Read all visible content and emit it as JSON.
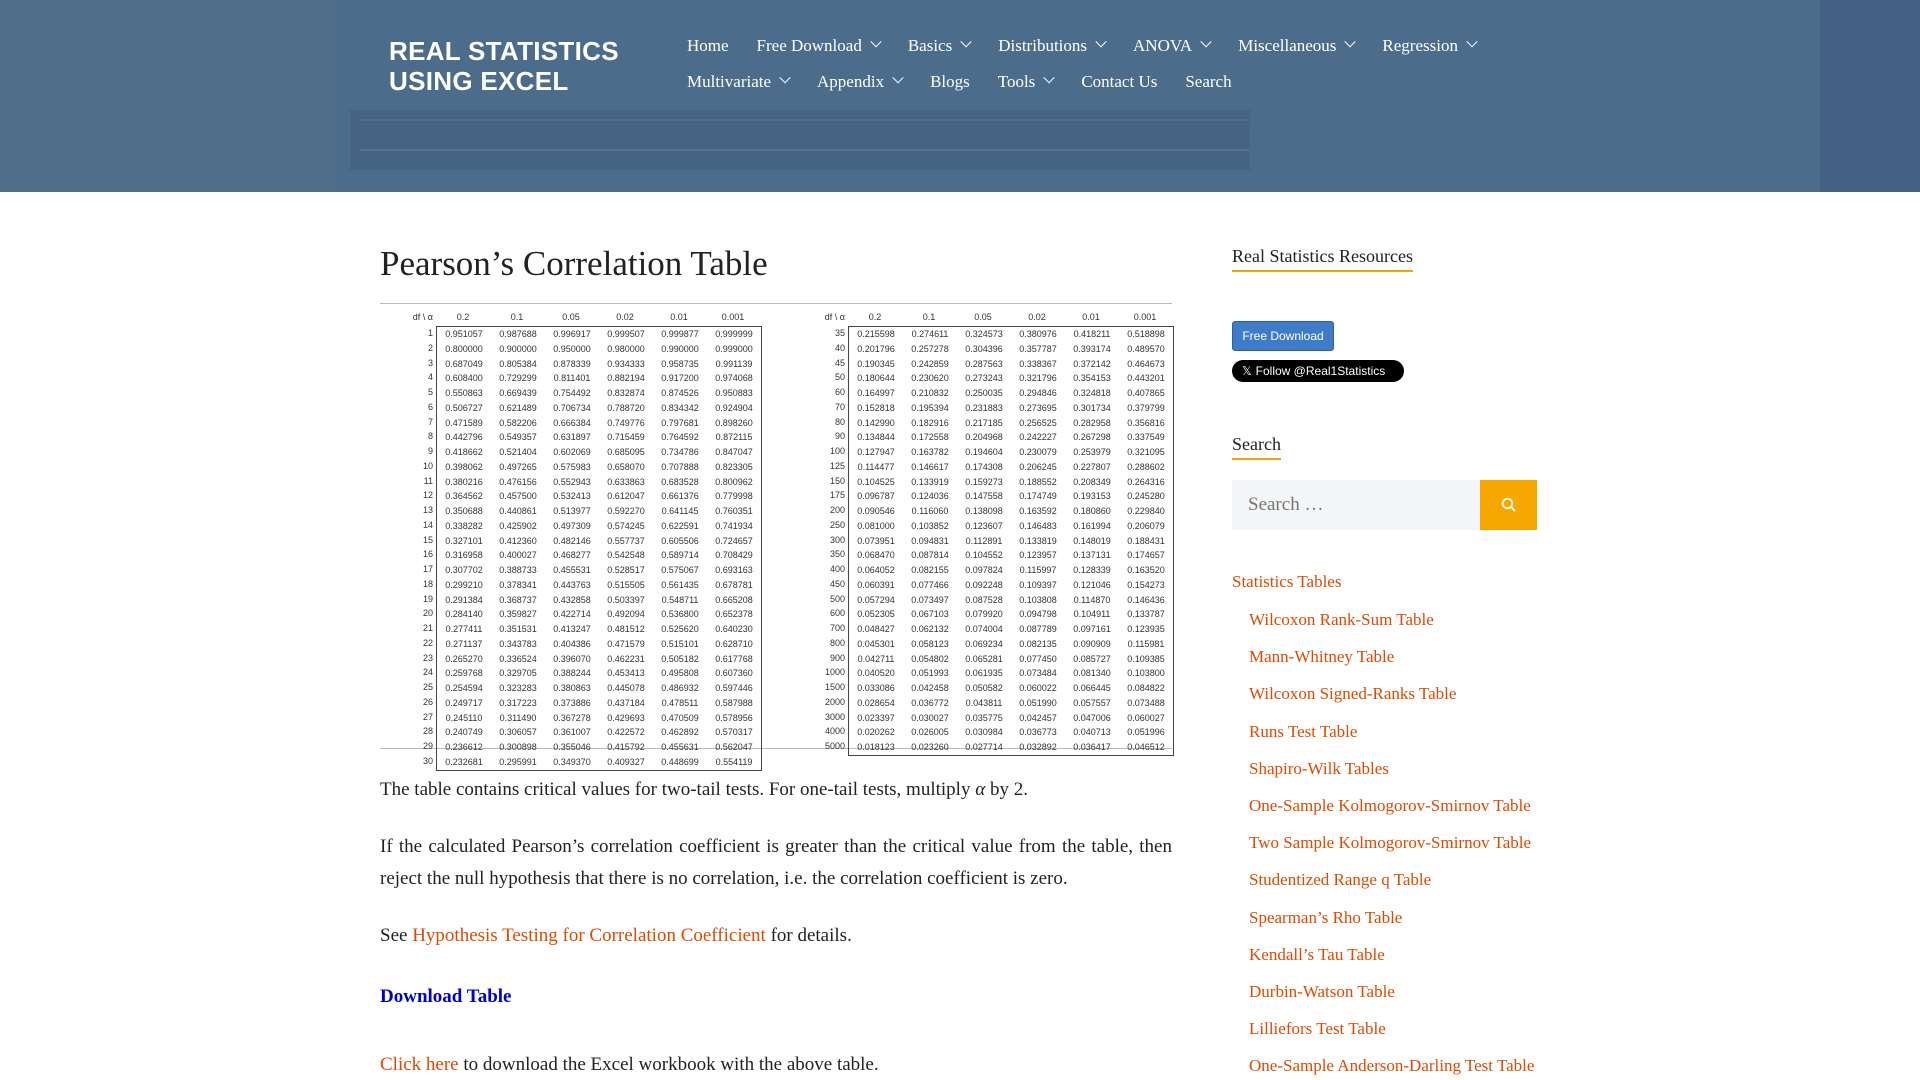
{
  "site": {
    "title_line1": "REAL STATISTICS",
    "title_line2": "USING EXCEL"
  },
  "nav": {
    "row1": [
      {
        "label": "Home",
        "dropdown": false
      },
      {
        "label": "Free Download",
        "dropdown": true
      },
      {
        "label": "Basics",
        "dropdown": true
      },
      {
        "label": "Distributions",
        "dropdown": true
      },
      {
        "label": "ANOVA",
        "dropdown": true
      },
      {
        "label": "Miscellaneous",
        "dropdown": true
      },
      {
        "label": "Regression",
        "dropdown": true
      }
    ],
    "row2": [
      {
        "label": "Multivariate",
        "dropdown": true
      },
      {
        "label": "Appendix",
        "dropdown": true
      },
      {
        "label": "Blogs",
        "dropdown": false
      },
      {
        "label": "Tools",
        "dropdown": true
      },
      {
        "label": "Contact Us",
        "dropdown": false
      },
      {
        "label": "Search",
        "dropdown": false
      }
    ]
  },
  "main": {
    "title": "Pearson’s Correlation Table",
    "table": {
      "corner": "df \\ α",
      "alphas": [
        "0.2",
        "0.1",
        "0.05",
        "0.02",
        "0.01",
        "0.001"
      ],
      "left": [
        [
          "1",
          "0.951057",
          "0.987688",
          "0.996917",
          "0.999507",
          "0.999877",
          "0.999999"
        ],
        [
          "2",
          "0.800000",
          "0.900000",
          "0.950000",
          "0.980000",
          "0.990000",
          "0.999000"
        ],
        [
          "3",
          "0.687049",
          "0.805384",
          "0.878339",
          "0.934333",
          "0.958735",
          "0.991139"
        ],
        [
          "4",
          "0.608400",
          "0.729299",
          "0.811401",
          "0.882194",
          "0.917200",
          "0.974068"
        ],
        [
          "5",
          "0.550863",
          "0.669439",
          "0.754492",
          "0.832874",
          "0.874526",
          "0.950883"
        ],
        [
          "6",
          "0.506727",
          "0.621489",
          "0.706734",
          "0.788720",
          "0.834342",
          "0.924904"
        ],
        [
          "7",
          "0.471589",
          "0.582206",
          "0.666384",
          "0.749776",
          "0.797681",
          "0.898260"
        ],
        [
          "8",
          "0.442796",
          "0.549357",
          "0.631897",
          "0.715459",
          "0.764592",
          "0.872115"
        ],
        [
          "9",
          "0.418662",
          "0.521404",
          "0.602069",
          "0.685095",
          "0.734786",
          "0.847047"
        ],
        [
          "10",
          "0.398062",
          "0.497265",
          "0.575983",
          "0.658070",
          "0.707888",
          "0.823305"
        ],
        [
          "11",
          "0.380216",
          "0.476156",
          "0.552943",
          "0.633863",
          "0.683528",
          "0.800962"
        ],
        [
          "12",
          "0.364562",
          "0.457500",
          "0.532413",
          "0.612047",
          "0.661376",
          "0.779998"
        ],
        [
          "13",
          "0.350688",
          "0.440861",
          "0.513977",
          "0.592270",
          "0.641145",
          "0.760351"
        ],
        [
          "14",
          "0.338282",
          "0.425902",
          "0.497309",
          "0.574245",
          "0.622591",
          "0.741934"
        ],
        [
          "15",
          "0.327101",
          "0.412360",
          "0.482146",
          "0.557737",
          "0.605506",
          "0.724657"
        ],
        [
          "16",
          "0.316958",
          "0.400027",
          "0.468277",
          "0.542548",
          "0.589714",
          "0.708429"
        ],
        [
          "17",
          "0.307702",
          "0.388733",
          "0.455531",
          "0.528517",
          "0.575067",
          "0.693163"
        ],
        [
          "18",
          "0.299210",
          "0.378341",
          "0.443763",
          "0.515505",
          "0.561435",
          "0.678781"
        ],
        [
          "19",
          "0.291384",
          "0.368737",
          "0.432858",
          "0.503397",
          "0.548711",
          "0.665208"
        ],
        [
          "20",
          "0.284140",
          "0.359827",
          "0.422714",
          "0.492094",
          "0.536800",
          "0.652378"
        ],
        [
          "21",
          "0.277411",
          "0.351531",
          "0.413247",
          "0.481512",
          "0.525620",
          "0.640230"
        ],
        [
          "22",
          "0.271137",
          "0.343783",
          "0.404386",
          "0.471579",
          "0.515101",
          "0.628710"
        ],
        [
          "23",
          "0.265270",
          "0.336524",
          "0.396070",
          "0.462231",
          "0.505182",
          "0.617768"
        ],
        [
          "24",
          "0.259768",
          "0.329705",
          "0.388244",
          "0.453413",
          "0.495808",
          "0.607360"
        ],
        [
          "25",
          "0.254594",
          "0.323283",
          "0.380863",
          "0.445078",
          "0.486932",
          "0.597446"
        ],
        [
          "26",
          "0.249717",
          "0.317223",
          "0.373886",
          "0.437184",
          "0.478511",
          "0.587988"
        ],
        [
          "27",
          "0.245110",
          "0.311490",
          "0.367278",
          "0.429693",
          "0.470509",
          "0.578956"
        ],
        [
          "28",
          "0.240749",
          "0.306057",
          "0.361007",
          "0.422572",
          "0.462892",
          "0.570317"
        ],
        [
          "29",
          "0.236612",
          "0.300898",
          "0.355046",
          "0.415792",
          "0.455631",
          "0.562047"
        ],
        [
          "30",
          "0.232681",
          "0.295991",
          "0.349370",
          "0.409327",
          "0.448699",
          "0.554119"
        ]
      ],
      "right": [
        [
          "35",
          "0.215598",
          "0.274611",
          "0.324573",
          "0.380976",
          "0.418211",
          "0.518898"
        ],
        [
          "40",
          "0.201796",
          "0.257278",
          "0.304396",
          "0.357787",
          "0.393174",
          "0.489570"
        ],
        [
          "45",
          "0.190345",
          "0.242859",
          "0.287563",
          "0.338367",
          "0.372142",
          "0.464673"
        ],
        [
          "50",
          "0.180644",
          "0.230620",
          "0.273243",
          "0.321796",
          "0.354153",
          "0.443201"
        ],
        [
          "60",
          "0.164997",
          "0.210832",
          "0.250035",
          "0.294846",
          "0.324818",
          "0.407865"
        ],
        [
          "70",
          "0.152818",
          "0.195394",
          "0.231883",
          "0.273695",
          "0.301734",
          "0.379799"
        ],
        [
          "80",
          "0.142990",
          "0.182916",
          "0.217185",
          "0.256525",
          "0.282958",
          "0.356816"
        ],
        [
          "90",
          "0.134844",
          "0.172558",
          "0.204968",
          "0.242227",
          "0.267298",
          "0.337549"
        ],
        [
          "100",
          "0.127947",
          "0.163782",
          "0.194604",
          "0.230079",
          "0.253979",
          "0.321095"
        ],
        [
          "125",
          "0.114477",
          "0.146617",
          "0.174308",
          "0.206245",
          "0.227807",
          "0.288602"
        ],
        [
          "150",
          "0.104525",
          "0.133919",
          "0.159273",
          "0.188552",
          "0.208349",
          "0.264316"
        ],
        [
          "175",
          "0.096787",
          "0.124036",
          "0.147558",
          "0.174749",
          "0.193153",
          "0.245280"
        ],
        [
          "200",
          "0.090546",
          "0.116060",
          "0.138098",
          "0.163592",
          "0.180860",
          "0.229840"
        ],
        [
          "250",
          "0.081000",
          "0.103852",
          "0.123607",
          "0.146483",
          "0.161994",
          "0.206079"
        ],
        [
          "300",
          "0.073951",
          "0.094831",
          "0.112891",
          "0.133819",
          "0.148019",
          "0.188431"
        ],
        [
          "350",
          "0.068470",
          "0.087814",
          "0.104552",
          "0.123957",
          "0.137131",
          "0.174657"
        ],
        [
          "400",
          "0.064052",
          "0.082155",
          "0.097824",
          "0.115997",
          "0.128339",
          "0.163520"
        ],
        [
          "450",
          "0.060391",
          "0.077466",
          "0.092248",
          "0.109397",
          "0.121046",
          "0.154273"
        ],
        [
          "500",
          "0.057294",
          "0.073497",
          "0.087528",
          "0.103808",
          "0.114870",
          "0.146436"
        ],
        [
          "600",
          "0.052305",
          "0.067103",
          "0.079920",
          "0.094798",
          "0.104911",
          "0.133787"
        ],
        [
          "700",
          "0.048427",
          "0.062132",
          "0.074004",
          "0.087789",
          "0.097161",
          "0.123935"
        ],
        [
          "800",
          "0.045301",
          "0.058123",
          "0.069234",
          "0.082135",
          "0.090909",
          "0.115981"
        ],
        [
          "900",
          "0.042711",
          "0.054802",
          "0.065281",
          "0.077450",
          "0.085727",
          "0.109385"
        ],
        [
          "1000",
          "0.040520",
          "0.051993",
          "0.061935",
          "0.073484",
          "0.081340",
          "0.103800"
        ],
        [
          "1500",
          "0.033086",
          "0.042458",
          "0.050582",
          "0.060022",
          "0.066445",
          "0.084822"
        ],
        [
          "2000",
          "0.028654",
          "0.036772",
          "0.043811",
          "0.051990",
          "0.057557",
          "0.073488"
        ],
        [
          "3000",
          "0.023397",
          "0.030027",
          "0.035775",
          "0.042457",
          "0.047006",
          "0.060027"
        ],
        [
          "4000",
          "0.020262",
          "0.026005",
          "0.030984",
          "0.036773",
          "0.040713",
          "0.051996"
        ],
        [
          "5000",
          "0.018123",
          "0.023260",
          "0.027714",
          "0.032892",
          "0.036417",
          "0.046512"
        ]
      ]
    },
    "p1_text": "The table contains critical values for two-tail tests. For one-tail tests, multiply",
    "p1_alpha": "α",
    "p1_end": "by 2.",
    "p2": "If the calculated Pearson’s correlation coefficient is greater than the critical value from the table, then reject the null hypothesis that there is no correlation, i.e. the correlation coefficient is zero.",
    "p3_pre": "See",
    "p3_link": "Hypothesis Testing for Correlation Coefficient",
    "p3_post": "for details.",
    "download_heading": "Download Table",
    "p4_link": "Click here",
    "p4_post": "to download the Excel workbook with the above table."
  },
  "sidebar": {
    "resources_title": "Real Statistics Resources",
    "free_download_btn": "Free Download",
    "follow_btn": "Follow @Real1Statistics",
    "search_title": "Search",
    "search_placeholder": "Search …",
    "tables_link": "Statistics Tables",
    "tables": [
      "Wilcoxon Rank-Sum Table",
      "Mann-Whitney Table",
      "Wilcoxon Signed-Ranks Table",
      "Runs Test Table",
      "Shapiro-Wilk Tables",
      "One-Sample Kolmogorov-Smirnov Table",
      "Two Sample Kolmogorov-Smirnov Table",
      "Studentized Range q Table",
      "Spearman’s Rho Table",
      "Kendall’s Tau Table",
      "Durbin-Watson Table",
      "Lilliefors Test Table",
      "One-Sample Anderson-Darling Test Table"
    ]
  },
  "colors": {
    "link": "#e04a00",
    "accent": "#f7a800",
    "header": "#4a6a8b",
    "download_heading": "#0000cc"
  }
}
